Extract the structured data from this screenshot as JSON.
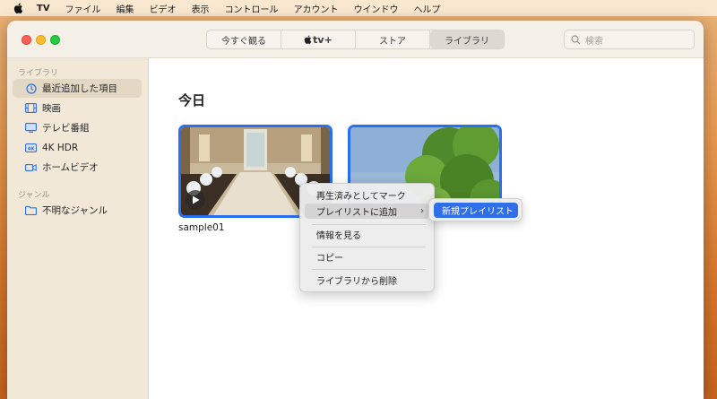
{
  "menubar": {
    "app_name": "TV",
    "items": [
      "ファイル",
      "編集",
      "ビデオ",
      "表示",
      "コントロール",
      "アカウント",
      "ウインドウ",
      "ヘルプ"
    ]
  },
  "toolbar": {
    "tabs": [
      {
        "label": "今すぐ観る",
        "active": false
      },
      {
        "label": "tv+",
        "active": false
      },
      {
        "label": "ストア",
        "active": false
      },
      {
        "label": "ライブラリ",
        "active": true
      }
    ],
    "search_placeholder": "検索"
  },
  "sidebar": {
    "library_heading": "ライブラリ",
    "library_items": [
      {
        "label": "最近追加した項目",
        "icon": "clock-icon",
        "selected": true
      },
      {
        "label": "映画",
        "icon": "film-icon",
        "selected": false
      },
      {
        "label": "テレビ番組",
        "icon": "tv-icon",
        "selected": false
      },
      {
        "label": "4K HDR",
        "icon": "4k-icon",
        "selected": false
      },
      {
        "label": "ホームビデオ",
        "icon": "video-camera-icon",
        "selected": false
      }
    ],
    "genre_heading": "ジャンル",
    "genre_items": [
      {
        "label": "不明なジャンル",
        "icon": "folder-icon",
        "selected": false
      }
    ]
  },
  "main": {
    "section_title": "今日",
    "videos": [
      {
        "title": "sample01"
      }
    ]
  },
  "context_menu": {
    "items": [
      {
        "label": "再生済みとしてマーク"
      },
      {
        "label": "プレイリストに追加",
        "has_submenu": true
      },
      {
        "label": "情報を見る"
      },
      {
        "label": "コピー"
      },
      {
        "label": "ライブラリから削除"
      }
    ],
    "submenu": {
      "items": [
        {
          "label": "新規プレイリスト"
        }
      ]
    }
  },
  "colors": {
    "accent": "#2f6fea",
    "thumb_border": "#2a6ff0",
    "sidebar_bg": "#f1e8d8"
  }
}
